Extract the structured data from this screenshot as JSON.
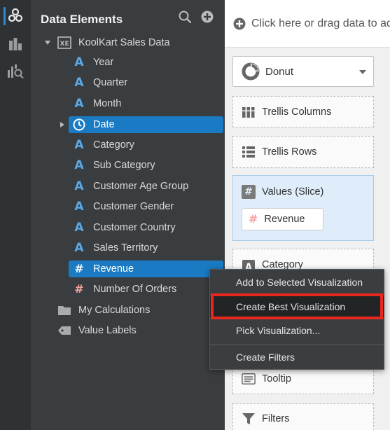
{
  "panel": {
    "title": "Data Elements",
    "source": {
      "label": "KoolKart Sales Data",
      "icon": "excel-file-icon",
      "expanded": true
    },
    "items": [
      {
        "label": "Year",
        "type": "attribute"
      },
      {
        "label": "Quarter",
        "type": "attribute"
      },
      {
        "label": "Month",
        "type": "attribute"
      },
      {
        "label": "Date",
        "type": "time",
        "selected": true
      },
      {
        "label": "Category",
        "type": "attribute"
      },
      {
        "label": "Sub Category",
        "type": "attribute"
      },
      {
        "label": "Customer Age Group",
        "type": "attribute"
      },
      {
        "label": "Customer Gender",
        "type": "attribute"
      },
      {
        "label": "Customer Country",
        "type": "attribute"
      },
      {
        "label": "Sales Territory",
        "type": "attribute"
      },
      {
        "label": "Revenue",
        "type": "measure",
        "selected": true
      },
      {
        "label": "Number Of Orders",
        "type": "measure"
      }
    ],
    "folders": [
      {
        "label": "My Calculations",
        "icon": "folder-icon"
      },
      {
        "label": "Value Labels",
        "icon": "tag-icon"
      }
    ]
  },
  "canvas": {
    "drop_hint": "Click here or drag data to ad",
    "viz_type": "Donut",
    "trellis_columns": "Trellis Columns",
    "trellis_rows": "Trellis Rows",
    "values": {
      "label": "Values (Slice)",
      "chip": "Revenue"
    },
    "category": "Category",
    "tooltip": "Tooltip",
    "filters": "Filters"
  },
  "context_menu": {
    "items": [
      "Add to Selected Visualization",
      "Create Best Visualization",
      "Pick Visualization...",
      "Create Filters"
    ],
    "highlighted": "Create Best Visualization"
  },
  "colors": {
    "accent": "#1a7bc4",
    "attribute_icon": "#5aa9e6",
    "measure_icon": "#f2a3a0",
    "highlight_box": "#e8271f"
  }
}
